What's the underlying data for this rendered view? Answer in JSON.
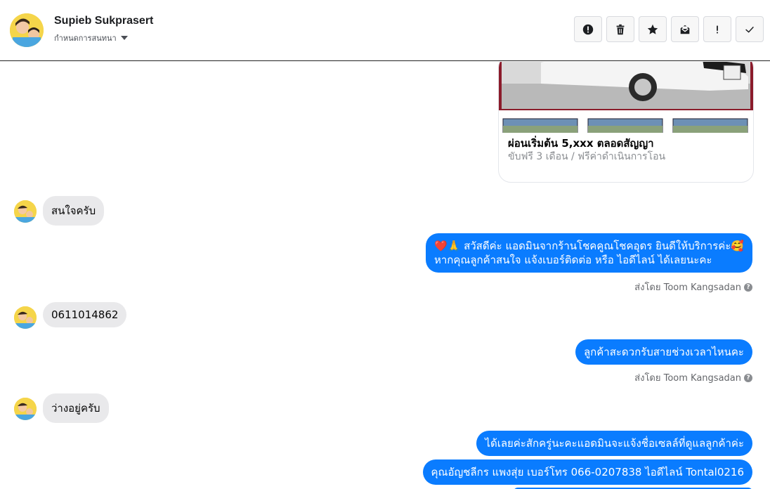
{
  "header": {
    "contact_name": "Supieb Sukprasert",
    "subtitle": "กำหนดการสนทนา"
  },
  "toolbar": {
    "buttons": [
      "alert-icon",
      "trash-icon",
      "star-icon",
      "mail-icon",
      "exclamation-icon",
      "check-icon"
    ]
  },
  "card": {
    "title": "ผ่อนเริ่มต้น 5,xxx ตลอดสัญญา",
    "subtitle": "ขับฟรี 3 เดือน / ฟรีค่าดำเนินการโอน"
  },
  "messages": [
    {
      "direction": "in",
      "text": "สนใจครับ"
    },
    {
      "direction": "out",
      "line1": "❤️🙏 สวัสดีค่ะ แอดมินจากร้านโชคคูณโชคอุดร ยินดีให้บริการค่ะ🥰",
      "line2": "หากคุณลูกค้าสนใจ แจ้งเบอร์ติดต่อ หรือ ไอดีไลน์ ได้เลยนะคะ",
      "sent_by": "ส่งโดย Toom Kangsadan"
    },
    {
      "direction": "in",
      "text": "0611014862"
    },
    {
      "direction": "out",
      "text": "ลูกค้าสะดวกรับสายช่วงเวลาไหนคะ",
      "sent_by": "ส่งโดย Toom Kangsadan"
    },
    {
      "direction": "in",
      "text": "ว่างอยู่ครับ"
    },
    {
      "direction": "out",
      "text": "ได้เลยค่ะสักครู่นะคะแอดมินจะแจ้งชื่อเซลล์ที่ดูแลลูกค้าค่ะ"
    },
    {
      "direction": "out",
      "text": "คุณอัญชลีกร แพงสุ่ย       เบอร์โทร 066-0207838 ไอดีไลน์ Tontal0216"
    }
  ],
  "colors": {
    "outgoing_bubble": "#0a7cff",
    "incoming_bubble": "#e9e9eb"
  }
}
